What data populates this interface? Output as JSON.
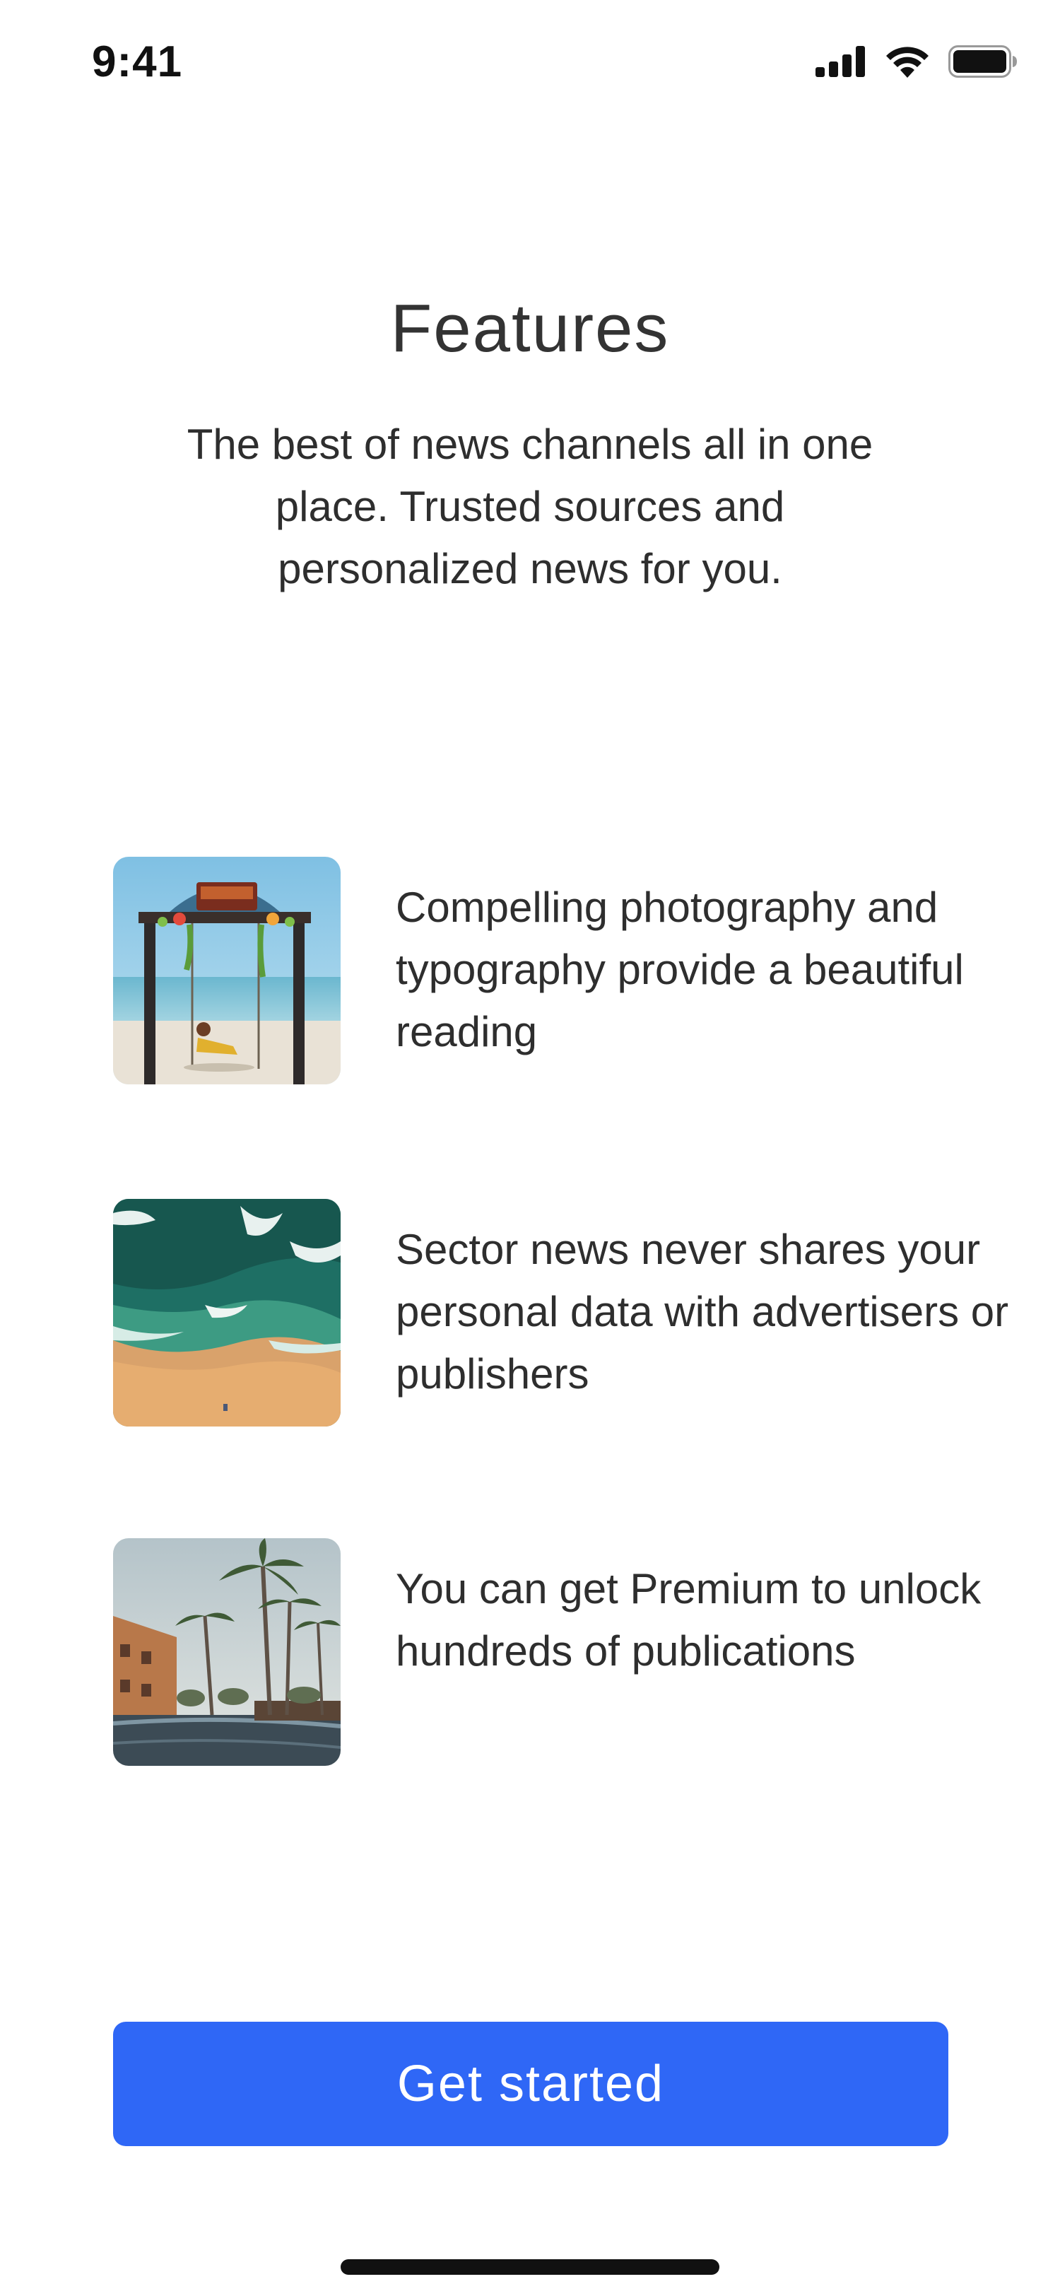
{
  "status_bar": {
    "time": "9:41",
    "icons": [
      "cellular-signal-icon",
      "wifi-icon",
      "battery-icon"
    ]
  },
  "header": {
    "title": "Features",
    "subtitle": "The best of news channels all in one place. Trusted sources and personalized news for you."
  },
  "features": [
    {
      "image": "beach-swing-image",
      "text": "Compelling photography and typography provide a beautiful reading"
    },
    {
      "image": "aerial-shore-image",
      "text": "Sector news never shares your personal data with advertisers or publishers"
    },
    {
      "image": "palm-resort-image",
      "text": "You can get Premium to unlock hundreds of publications"
    }
  ],
  "cta": {
    "label": "Get started",
    "color": "#2f67f6"
  }
}
